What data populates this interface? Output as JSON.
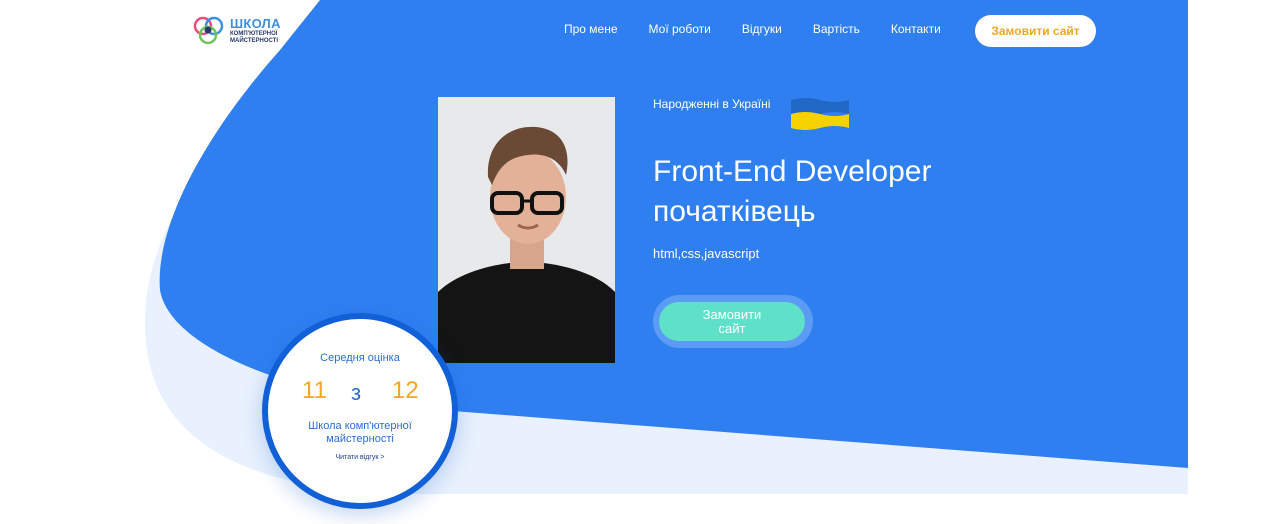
{
  "logo": {
    "title": "ШКОЛА",
    "subtitle_line1": "КОМП'ЮТЕРНОЇ",
    "subtitle_line2": "МАЙСТЕРНОСТІ"
  },
  "nav": {
    "items": [
      {
        "label": "Про мене"
      },
      {
        "label": "Мої роботи"
      },
      {
        "label": "Відгуки"
      },
      {
        "label": "Вартість"
      },
      {
        "label": "Контакти"
      }
    ],
    "cta_label": "Замовити сайт"
  },
  "hero": {
    "born_text": "Народженні в Україні",
    "headline_line1": "Front-End Developer",
    "headline_line2": "початківець",
    "skills": "html,css,javascript",
    "cta_label": "Замовити сайт"
  },
  "rating": {
    "label": "Середня оцінка",
    "score": "11",
    "separator": "з",
    "max": "12",
    "school": "Школа комп'ютерної майстерності",
    "link": "Читати відгук >"
  },
  "colors": {
    "primary_blue": "#2f7ff0",
    "light_blue_band": "#e8f1fd",
    "accent_orange": "#f5a623",
    "teal": "#5fe0c8"
  }
}
